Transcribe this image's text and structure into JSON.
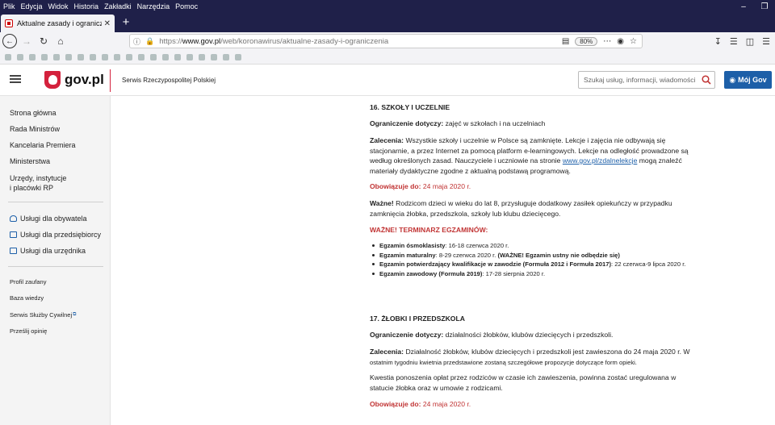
{
  "browser": {
    "menu": [
      "Plik",
      "Edycja",
      "Widok",
      "Historia",
      "Zakładki",
      "Narzędzia",
      "Pomoc"
    ],
    "tab_title": "Aktualne zasady i ograniczenia",
    "url": {
      "protocol": "https://",
      "host": "www.gov.pl",
      "path": "/web/koronawirus/aktualne-zasady-i-ograniczenia"
    },
    "zoom": "80%"
  },
  "header": {
    "logo": "gov.pl",
    "service_name": "Serwis Rzeczypospolitej Polskiej",
    "search_placeholder": "Szukaj usług, informacji, wiadomości",
    "my_gov_label": "Mój Gov"
  },
  "sidebar": {
    "nav": [
      "Strona główna",
      "Rada Ministrów",
      "Kancelaria Premiera",
      "Ministerstwa"
    ],
    "offices": [
      "Urzędy, instytucje",
      "i placówki RP"
    ],
    "services": [
      "Usługi dla obywatela",
      "Usługi dla przedsiębiorcy",
      "Usługi dla urzędnika"
    ],
    "footer_links": [
      "Profil zaufany",
      "Baza wiedzy",
      "Serwis Służby Cywilnej",
      "Prześlij opinię"
    ]
  },
  "content": {
    "s16": {
      "title": "16. SZKOŁY I UCZELNIE",
      "scope_label": "Ograniczenie dotyczy:",
      "scope_text": "zajęć w szkołach i na uczelniach",
      "rec_label": "Zalecenia:",
      "rec_text": "Wszystkie szkoły i uczelnie w Polsce są zamknięte. Lekcje i zajęcia nie odbywają się stacjonarnie, a przez Internet za pomocą platform e-learningowych. Lekcje na odległość prowadzone są według określonych zasad. Nauczyciele i uczniowie na stronie",
      "rec_link": "www.gov.pl/zdalnelekcje",
      "rec_text_after": "mogą znaleźć materiały dydaktyczne zgodne z aktualną podstawą programową.",
      "valid_label": "Obowiązuje do:",
      "valid_date": "24 maja 2020 r.",
      "important_label": "Ważne!",
      "important_text": "Rodzicom dzieci w wieku do lat 8, przysługuje dodatkowy zasiłek opiekuńczy w przypadku zamknięcia żłobka, przedszkola, szkoły lub klubu dziecięcego.",
      "exams_title": "WAŻNE! TERMINARZ EGZAMINÓW:",
      "exams": [
        {
          "name": "Egzamin ósmoklasisty",
          "date": ": 16-18 czerwca 2020 r.",
          "note": ""
        },
        {
          "name": "Egzamin maturalny",
          "date": ": 8-29 czerwca 2020 r. ",
          "note": "(WAŻNE! Egzamin ustny nie odbędzie się)"
        },
        {
          "name": "Egzamin potwierdzający kwalifikacje w zawodzie (Formuła 2012 i Formuła 2017)",
          "date": ": 22 czerwca-9 lipca 2020 r.",
          "note": ""
        },
        {
          "name": "Egzamin zawodowy (Formuła 2019)",
          "date": ": 17-28 sierpnia 2020 r.",
          "note": ""
        }
      ]
    },
    "s17": {
      "title": "17. ŻŁOBKI I PRZEDSZKOLA",
      "scope_label": "Ograniczenie dotyczy:",
      "scope_text": "działalności żłobków, klubów dziecięcych i przedszkoli.",
      "rec_label": "Zalecenia:",
      "rec_text": "Działalność żłobków, klubów dziecięcych i przedszkoli jest zawieszona do 24 maja 2020 r. W",
      "rec_note": "ostatnim tygodniu kwietnia przedstawione zostaną szczegółowe propozycje dotyczące form opieki.",
      "fee_text": "Kwestia ponoszenia opłat przez rodziców w czasie ich zawieszenia, powinna zostać uregulowana w statucie żłobka oraz w umowie z rodzicami.",
      "valid_label": "Obowiązuje do:",
      "valid_date": "24 maja 2020 r."
    }
  }
}
